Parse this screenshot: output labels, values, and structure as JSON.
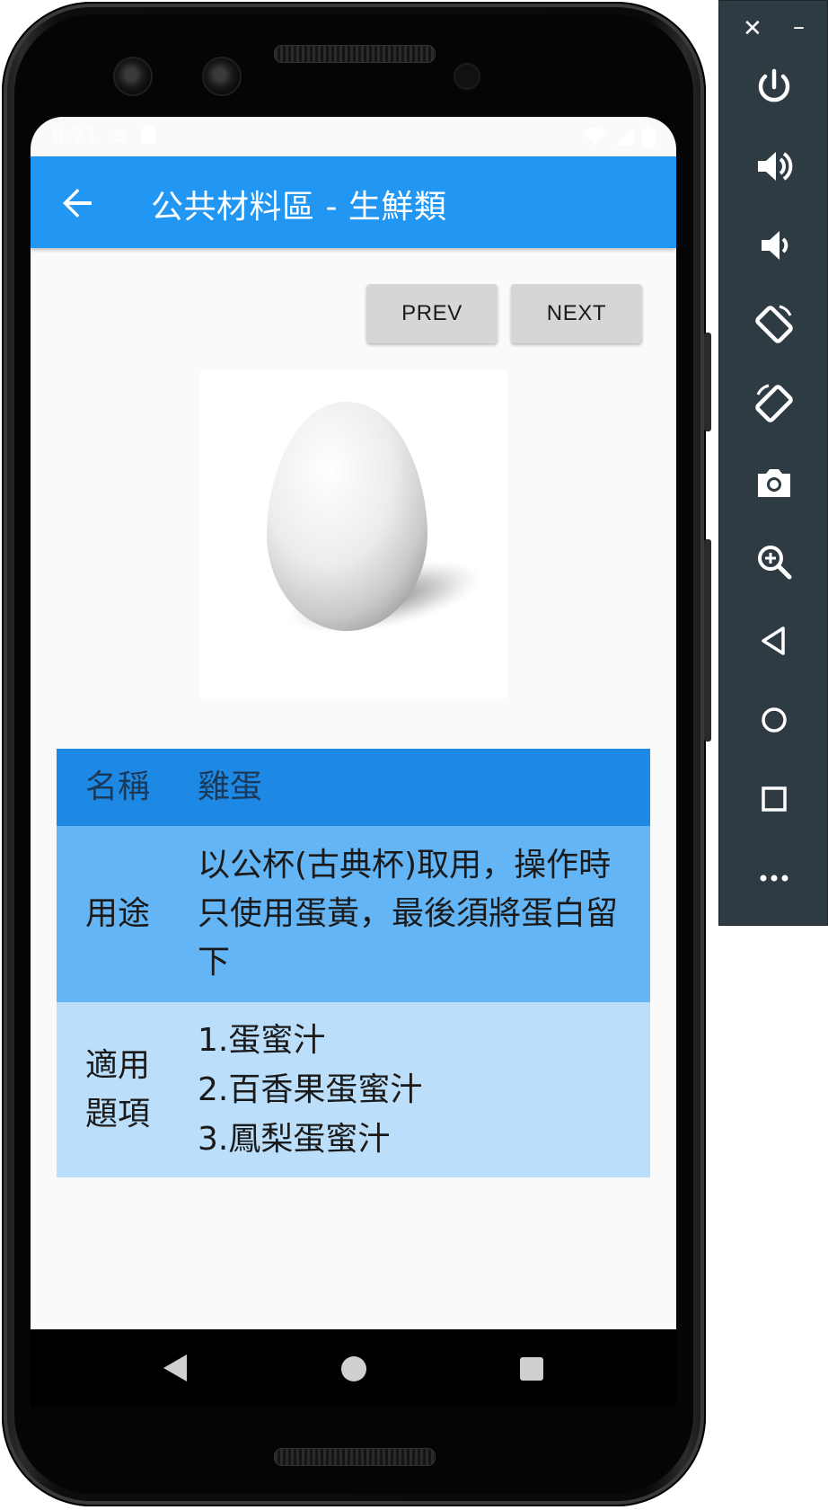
{
  "status_bar": {
    "time": "9:21"
  },
  "app_bar": {
    "title": "公共材料區 - 生鮮類"
  },
  "buttons": {
    "prev": "PREV",
    "next": "NEXT"
  },
  "table": {
    "name_label": "名稱",
    "name_value": "雞蛋",
    "usage_label": "用途",
    "usage_value": "以公杯(古典杯)取用，操作時只使用蛋黃，最後須將蛋白留下",
    "items_label_line1": "適用",
    "items_label_line2": "題項",
    "items": [
      "1.蛋蜜汁",
      "2.百香果蛋蜜汁",
      "3.鳳梨蛋蜜汁"
    ]
  },
  "colors": {
    "app_bar": "#2196f3",
    "row_name": "#1e88e5",
    "row_usage": "#64b5f6",
    "row_items": "#bbdefb",
    "button": "#d6d6d6",
    "emulator_toolbar": "#2f3b43"
  },
  "emulator_toolbar": {
    "icons": [
      "power-icon",
      "volume-up-icon",
      "volume-down-icon",
      "rotate-left-icon",
      "rotate-right-icon",
      "camera-icon",
      "zoom-icon",
      "back-icon",
      "home-icon",
      "overview-icon",
      "more-icon"
    ]
  }
}
